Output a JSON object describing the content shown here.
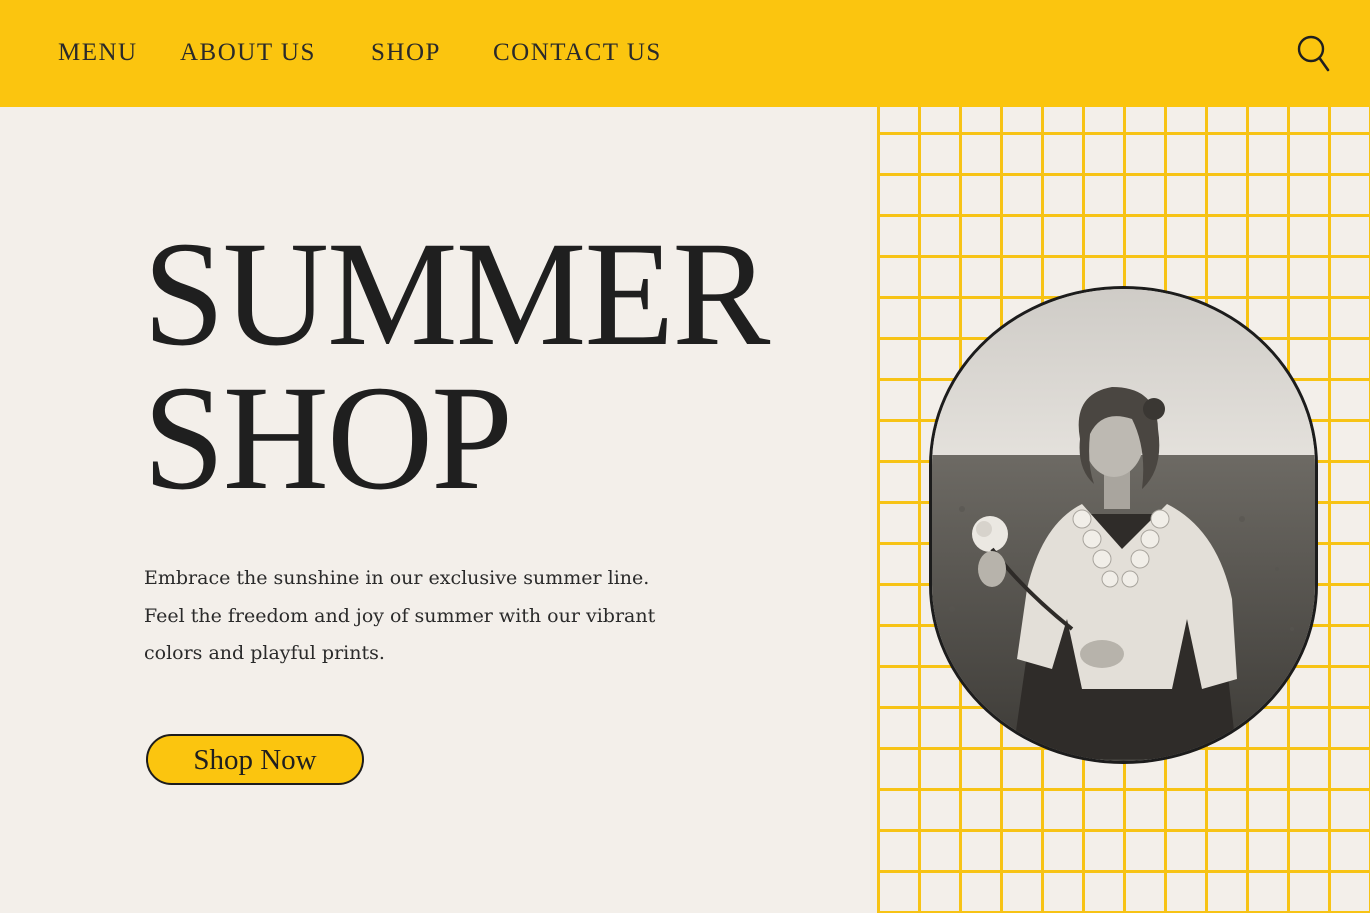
{
  "nav": {
    "items": [
      {
        "label": "MENU"
      },
      {
        "label": "ABOUT US"
      },
      {
        "label": "SHOP"
      },
      {
        "label": "CONTACT US"
      }
    ],
    "search_icon": "search-icon"
  },
  "hero": {
    "title_line1": "SUMMER",
    "title_line2": "SHOP",
    "description_lines": [
      "Embrace the sunshine in our exclusive summer line.",
      "Feel the freedom and joy of summer with our vibrant",
      "colors and playful prints."
    ],
    "cta_label": "Shop Now"
  },
  "colors": {
    "accent": "#fbc50f",
    "background": "#f3efea",
    "text": "#1c1c1c"
  }
}
